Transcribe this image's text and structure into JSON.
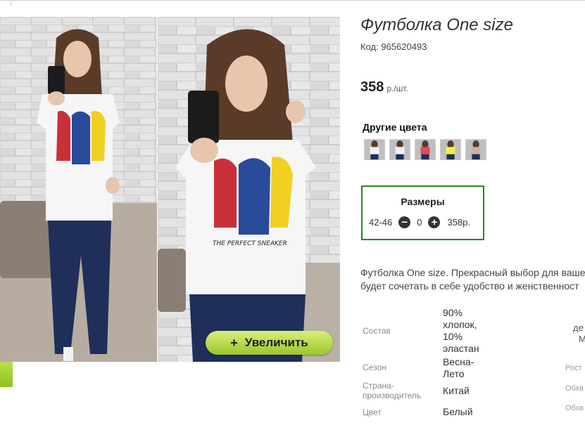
{
  "product": {
    "title": "Футболка One size",
    "code": "Код: 965620493",
    "price_value": "358",
    "price_unit": "р./шт."
  },
  "gallery": {
    "zoom_plus": "+",
    "zoom_label": "Увеличить",
    "print_text": "THE PERFECT SNEAKER"
  },
  "colors": {
    "title": "Другие цвета",
    "swatches": [
      "#f2f2f2",
      "#f0f0f0",
      "#e8485a",
      "#f2f04a",
      "#c9b2a0"
    ]
  },
  "sizes": {
    "title": "Размеры",
    "size": "42-46",
    "minus": "−",
    "qty": "0",
    "plus": "+",
    "price": "358р."
  },
  "description": {
    "line1": "Футболка One size. Прекрасный выбор для ваше",
    "line2": "будет сочетать в себе удобство и женственност"
  },
  "properties": [
    {
      "label": "Состав",
      "value": [
        "90%",
        "хлопок,",
        "10%",
        "эластан"
      ]
    },
    {
      "label": "Сезон",
      "value": [
        "Весна-",
        "Лето"
      ]
    },
    {
      "label": "Страна-\nпроизводитель",
      "value": [
        "Китай"
      ]
    },
    {
      "label": "Цвет",
      "value": [
        "Белый"
      ]
    }
  ],
  "right_cut": {
    "t1": "де",
    "t2": "М",
    "t3": "Рост",
    "t4": "Обхв",
    "t5": "Обхв"
  }
}
